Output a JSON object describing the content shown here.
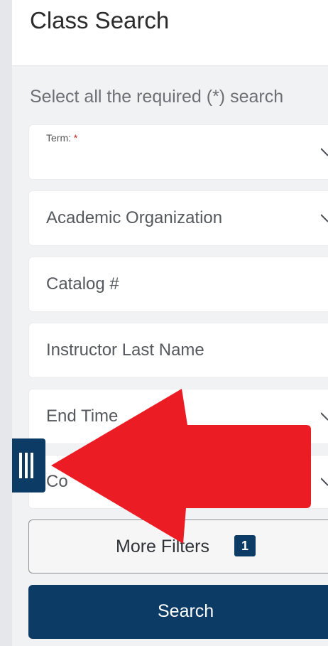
{
  "header": {
    "title": "Class Search"
  },
  "instructions": "Select all the required (*) search",
  "fields": {
    "term": {
      "label": "Term:",
      "required_mark": "*"
    },
    "academic_org": {
      "label": "Academic Organization"
    },
    "catalog": {
      "label": "Catalog #"
    },
    "instructor": {
      "label": "Instructor Last Name"
    },
    "end_time": {
      "label": "End Time"
    },
    "course": {
      "label": "Co"
    }
  },
  "more_filters": {
    "label": "More Filters",
    "badge": "1"
  },
  "search_button": {
    "label": "Search"
  },
  "colors": {
    "primary": "#0c3b66",
    "annotation_arrow": "#ec1c24",
    "required": "#c62828"
  },
  "icons": {
    "dropdown": "chevron-down-icon",
    "handle": "drag-handle-icon",
    "annotation": "left-arrow-annotation"
  }
}
